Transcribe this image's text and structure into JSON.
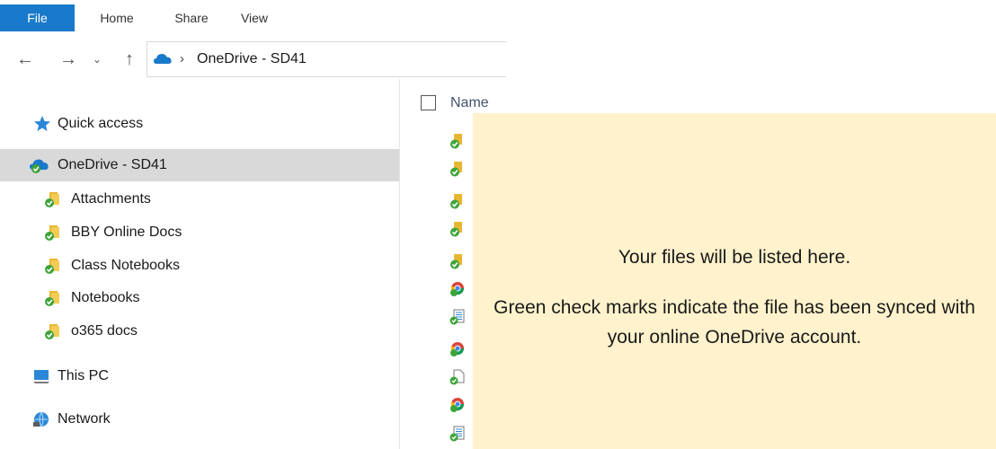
{
  "ribbon": {
    "tabs": [
      {
        "label": "File",
        "active": true
      },
      {
        "label": "Home",
        "active": false
      },
      {
        "label": "Share",
        "active": false
      },
      {
        "label": "View",
        "active": false
      }
    ]
  },
  "address_bar": {
    "path": "OneDrive - SD41"
  },
  "nav": {
    "quick_access": "Quick access",
    "onedrive": "OneDrive - SD41",
    "folders": [
      "Attachments",
      "BBY Online Docs",
      "Class Notebooks",
      "Notebooks",
      "o365 docs"
    ],
    "this_pc": "This PC",
    "network": "Network"
  },
  "content": {
    "column_name": "Name",
    "file_icons": [
      "folder-synced",
      "folder-synced",
      "folder-synced",
      "folder-synced",
      "folder-synced",
      "chrome-synced",
      "document-synced",
      "chrome-synced",
      "file-synced",
      "chrome-synced",
      "document-synced"
    ]
  },
  "overlay": {
    "line1": "Your files will be listed here.",
    "line2": "Green check marks indicate the file has been synced with your online OneDrive account."
  },
  "colors": {
    "accent": "#1979ca",
    "selection": "#d9d9d9",
    "overlay_bg": "#fff2cc",
    "sync_green": "#3fa43b",
    "folder_yellow": "#e8b631"
  }
}
